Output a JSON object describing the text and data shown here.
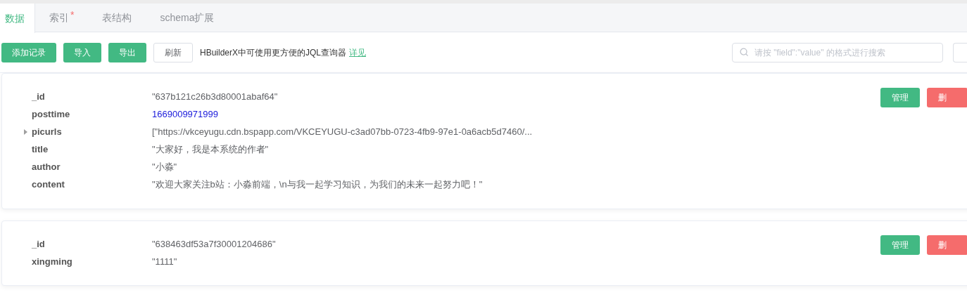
{
  "tabs": [
    {
      "label": "数据",
      "selected": true
    },
    {
      "label": "索引",
      "selected": false,
      "marker": "*"
    },
    {
      "label": "表结构",
      "selected": false
    },
    {
      "label": "schema扩展",
      "selected": false
    }
  ],
  "toolbar": {
    "buttons": [
      {
        "label": "添加记录",
        "kind": "primary"
      },
      {
        "label": "导入",
        "kind": "primary"
      },
      {
        "label": "导出",
        "kind": "primary"
      },
      {
        "label": "刷新",
        "kind": "plain"
      }
    ],
    "hint": "HBuilderX中可使用更方便的JQL查询器",
    "hint_link": "详见",
    "search": {
      "placeholder": "请按 \"field\":\"value\" 的格式进行搜索"
    }
  },
  "records": [
    {
      "fields": [
        {
          "key": "_id",
          "value": "\"637b121c26b3d80001abaf64\"",
          "kind": "string"
        },
        {
          "key": "posttime",
          "value": "1669009971999",
          "kind": "number"
        },
        {
          "key": "picurls",
          "value": "[\"https://vkceyugu.cdn.bspapp.com/VKCEYUGU-c3ad07bb-0723-4fb9-97e1-0a6acb5d7460/...",
          "kind": "array"
        },
        {
          "key": "title",
          "value": "\"大家好，我是本系统的作者\"",
          "kind": "string"
        },
        {
          "key": "author",
          "value": "\"小淼\"",
          "kind": "string"
        },
        {
          "key": "content",
          "value": "\"欢迎大家关注b站：小淼前端，\\n与我一起学习知识，为我们的未来一起努力吧！\"",
          "kind": "string"
        }
      ],
      "manage": "管理",
      "delete": "删"
    },
    {
      "fields": [
        {
          "key": "_id",
          "value": "\"638463df53a7f30001204686\"",
          "kind": "string"
        },
        {
          "key": "xingming",
          "value": "\"1111\"",
          "kind": "string"
        }
      ],
      "manage": "管理",
      "delete": "删"
    }
  ]
}
